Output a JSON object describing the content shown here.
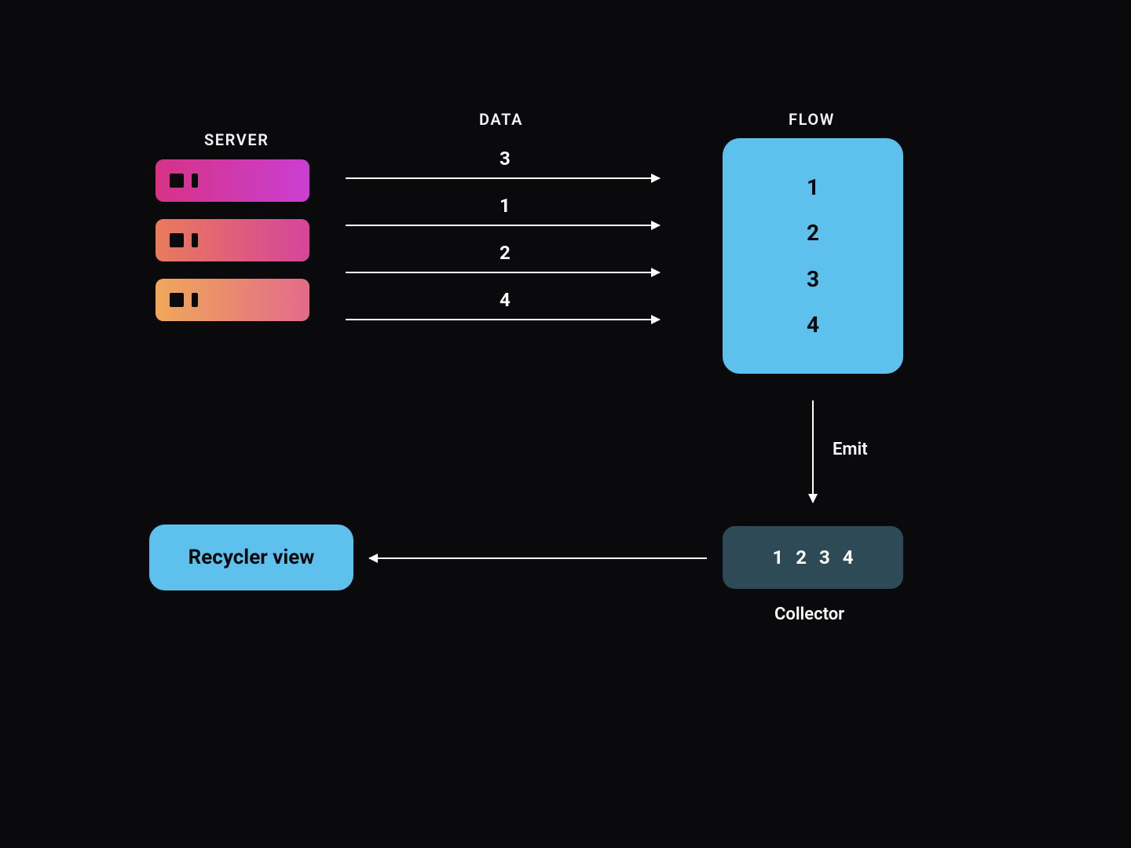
{
  "labels": {
    "server": "SERVER",
    "data": "DATA",
    "flow": "FLOW",
    "emit": "Emit",
    "collector": "Collector",
    "recycler": "Recycler view"
  },
  "data_stream": [
    "3",
    "1",
    "2",
    "4"
  ],
  "flow_items": [
    "1",
    "2",
    "3",
    "4"
  ],
  "collector_items": [
    "1",
    "2",
    "3",
    "4"
  ]
}
